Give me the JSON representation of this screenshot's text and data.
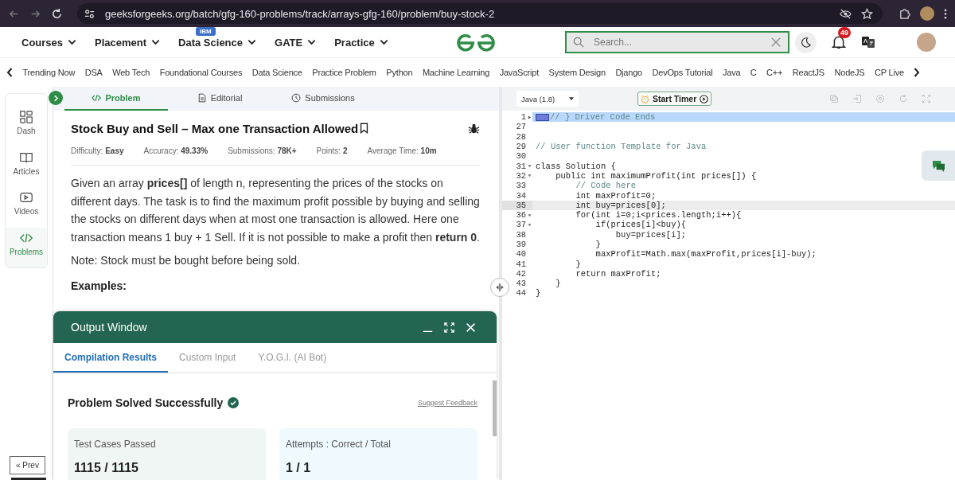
{
  "browser": {
    "url": "geeksforgeeks.org/batch/gfg-160-problems/track/arrays-gfg-160/problem/buy-stock-2"
  },
  "nav": {
    "items": [
      {
        "label": "Courses"
      },
      {
        "label": "Placement"
      },
      {
        "label": "Data Science",
        "badge": "IBM"
      },
      {
        "label": "GATE"
      },
      {
        "label": "Practice"
      }
    ],
    "search": {
      "placeholder": "Search..."
    },
    "notifications": "49"
  },
  "subnav": [
    "Trending Now",
    "DSA",
    "Web Tech",
    "Foundational Courses",
    "Data Science",
    "Practice Problem",
    "Python",
    "Machine Learning",
    "JavaScript",
    "System Design",
    "Django",
    "DevOps Tutorial",
    "Java",
    "C",
    "C++",
    "ReactJS",
    "NodeJS",
    "CP Live"
  ],
  "sidebar": {
    "items": [
      {
        "label": "Dash",
        "kind": "dash",
        "selected": false
      },
      {
        "label": "Articles",
        "kind": "articles",
        "selected": false
      },
      {
        "label": "Videos",
        "kind": "videos",
        "selected": false
      },
      {
        "label": "Problems",
        "kind": "problems",
        "selected": true
      }
    ],
    "prev": "« Prev"
  },
  "problem_tabs": [
    {
      "label": "Problem",
      "kind": "code",
      "selected": true
    },
    {
      "label": "Editorial",
      "kind": "doc",
      "selected": false
    },
    {
      "label": "Submissions",
      "kind": "clock",
      "selected": false
    }
  ],
  "problem": {
    "title": "Stock Buy and Sell – Max one Transaction Allowed",
    "meta": [
      "Difficulty: **Easy**",
      "Accuracy: **49.33%**",
      "Submissions: **78K+**",
      "Points: **2**",
      "Average Time: **10m**"
    ],
    "description": "Given an array **prices[]** of length n, representing the prices of the stocks on different days. The task is to find the maximum profit possible by buying and selling the stocks on different days when at most one transaction is allowed. Here one transaction means 1 buy + 1 Sell. If it is not possible to make a profit then **return 0**.",
    "note": "Note: Stock must be bought before being sold.",
    "examples_heading": "Examples:"
  },
  "output": {
    "title": "Output Window",
    "tabs": [
      {
        "label": "Compilation Results",
        "selected": true
      },
      {
        "label": "Custom Input",
        "selected": false
      },
      {
        "label": "Y.O.G.I. (AI Bot)",
        "selected": false
      }
    ],
    "status": "Problem Solved Successfully",
    "feedback": "Suggest Feedback",
    "cards": [
      {
        "label": "Test Cases Passed",
        "value": "1115 / 1115",
        "color": "#f0f6f4"
      },
      {
        "label": "Attempts : Correct / Total",
        "value": "1 / 1",
        "color": "#eefaff"
      }
    ]
  },
  "editor": {
    "language": "Java (1.8)",
    "timer": "Start Timer",
    "lines": [
      {
        "number": "1",
        "text": "// } Driver Code Ends",
        "kind": "comment",
        "foldable": true,
        "folded": true,
        "highlighted": true,
        "current": false
      },
      {
        "number": "27",
        "foldable": false,
        "folded": false,
        "highlighted": false,
        "current": false
      },
      {
        "number": "28",
        "foldable": false,
        "folded": false,
        "highlighted": false,
        "current": false
      },
      {
        "number": "29",
        "text": "// User function Template for Java",
        "kind": "comment",
        "foldable": false,
        "folded": false,
        "highlighted": false,
        "current": false
      },
      {
        "number": "30",
        "foldable": false,
        "folded": false,
        "highlighted": false,
        "current": false
      },
      {
        "number": "31",
        "text": "class Solution {",
        "kind": "code",
        "foldable": true,
        "folded": false,
        "highlighted": false,
        "current": false
      },
      {
        "number": "32",
        "text": "    public int maximumProfit(int prices[]) {",
        "kind": "code",
        "foldable": true,
        "folded": false,
        "highlighted": false,
        "current": false
      },
      {
        "number": "33",
        "text": "        // Code here",
        "kind": "comment",
        "foldable": false,
        "folded": false,
        "highlighted": false,
        "current": false
      },
      {
        "number": "34",
        "text": "        int maxProfit=0;",
        "kind": "code",
        "foldable": false,
        "folded": false,
        "highlighted": false,
        "current": false
      },
      {
        "number": "35",
        "text": "        int buy=prices[0];",
        "kind": "code",
        "foldable": false,
        "folded": false,
        "highlighted": false,
        "current": true
      },
      {
        "number": "36",
        "text": "        for(int i=0;i<prices.length;i++){",
        "kind": "code",
        "foldable": true,
        "folded": false,
        "highlighted": false,
        "current": false
      },
      {
        "number": "37",
        "text": "            if(prices[i]<buy){",
        "kind": "code",
        "foldable": true,
        "folded": false,
        "highlighted": false,
        "current": false
      },
      {
        "number": "38",
        "text": "                buy=prices[i];",
        "kind": "code",
        "foldable": false,
        "folded": false,
        "highlighted": false,
        "current": false
      },
      {
        "number": "39",
        "text": "            }",
        "kind": "code",
        "foldable": false,
        "folded": false,
        "highlighted": false,
        "current": false
      },
      {
        "number": "40",
        "text": "            maxProfit=Math.max(maxProfit,prices[i]-buy);",
        "kind": "code",
        "foldable": false,
        "folded": false,
        "highlighted": false,
        "current": false
      },
      {
        "number": "41",
        "text": "        }",
        "kind": "code",
        "foldable": false,
        "folded": false,
        "highlighted": false,
        "current": false
      },
      {
        "number": "42",
        "text": "        return maxProfit;",
        "kind": "code",
        "foldable": false,
        "folded": false,
        "highlighted": false,
        "current": false
      },
      {
        "number": "43",
        "text": "    }",
        "kind": "code",
        "foldable": false,
        "folded": false,
        "highlighted": false,
        "current": false
      },
      {
        "number": "44",
        "text": "}",
        "kind": "code",
        "foldable": false,
        "folded": false,
        "highlighted": false,
        "current": false
      }
    ]
  }
}
